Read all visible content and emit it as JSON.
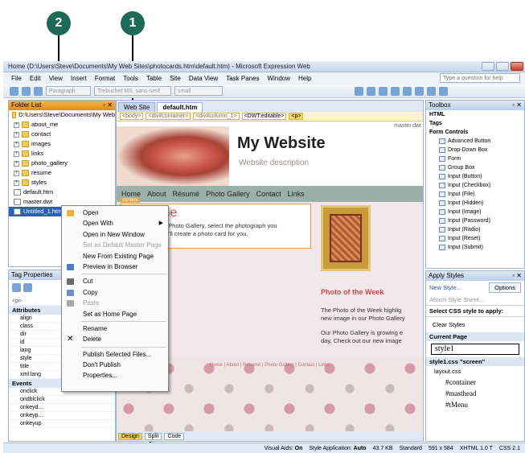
{
  "callouts": {
    "one": "1",
    "two": "2"
  },
  "window": {
    "title": "Home (D:\\Users\\Steve\\Documents\\My Web Sites\\photocards.htm\\default.htm) - Microsoft Expression Web"
  },
  "menu": [
    "File",
    "Edit",
    "View",
    "Insert",
    "Format",
    "Tools",
    "Table",
    "Site",
    "Data View",
    "Task Panes",
    "Window",
    "Help"
  ],
  "help_placeholder": "Type a question for help",
  "toolbar": {
    "style": "Paragraph",
    "font": "Trebuchet MS, sans-serif",
    "size": "small"
  },
  "folder_list": {
    "title": "Folder List",
    "items": [
      {
        "label": "D:\\Users\\Steve\\Documents\\My Web",
        "type": "root"
      },
      {
        "label": "about_me",
        "type": "folder"
      },
      {
        "label": "contact",
        "type": "folder"
      },
      {
        "label": "images",
        "type": "folder"
      },
      {
        "label": "links",
        "type": "folder"
      },
      {
        "label": "photo_gallery",
        "type": "folder"
      },
      {
        "label": "resume",
        "type": "folder"
      },
      {
        "label": "styles",
        "type": "folder"
      },
      {
        "label": "default.htm",
        "type": "file"
      },
      {
        "label": "master.dwt",
        "type": "file"
      },
      {
        "label": "Untitled_1.htm",
        "type": "file-selected"
      }
    ]
  },
  "tag_properties": {
    "title": "Tag Properties",
    "tag": "<p>",
    "attributes_header": "Attributes",
    "attributes": [
      "align",
      "class",
      "dir",
      "id",
      "lang",
      "style",
      "title",
      "xml:lang"
    ],
    "events_header": "Events",
    "events": [
      "onclick",
      "ondblclick",
      "onkeyd...",
      "onkeyp...",
      "onkeyup"
    ]
  },
  "editor": {
    "tabs": [
      "Web Site",
      "default.htm"
    ],
    "crumbs": [
      "<body>",
      "<div#container>",
      "<div#column_1>",
      "<DWT:editable>",
      "<p>"
    ],
    "master_label": "master.dwt",
    "site_title": "My Website",
    "site_desc": "Website description",
    "nav": [
      "Home",
      "About",
      "Résumé",
      "Photo Gallery",
      "Contact",
      "Links"
    ],
    "content_tag": "content",
    "welcome": "Welcome",
    "welcome_text_1": "h our Photo Gallery, select the photograph you",
    "welcome_text_2": "nd we'll create a photo card for you.",
    "potw_title": "Photo of the Week",
    "potw_text_1": "The Photo of the Week highlig",
    "potw_text_2": "new image in our Photo Gallery",
    "potw_text_3": "Our Photo Gallery is growing e",
    "potw_text_4": "day. Check out our new image",
    "footer_links": "Home | About | Résumé | Photo Gallery | Contact | Links",
    "views": [
      "Design",
      "Split",
      "Code"
    ]
  },
  "toolbox": {
    "title": "Toolbox",
    "sections": [
      "HTML",
      "Tags",
      "Form Controls"
    ],
    "items": [
      "Advanced Button",
      "Drop-Down Box",
      "Form",
      "Group Box",
      "Input (Button)",
      "Input (Checkbox)",
      "Input (File)",
      "Input (Hidden)",
      "Input (Image)",
      "Input (Password)",
      "Input (Radio)",
      "Input (Reset)",
      "Input (Submit)"
    ]
  },
  "apply_styles": {
    "title": "Apply Styles",
    "new_style": "New Style...",
    "options": "Options",
    "attach": "Attach Style Sheet...",
    "select_label": "Select CSS style to apply:",
    "clear": "Clear Styles",
    "current_page": "Current Page",
    "style1": "style1",
    "style1css": "style1.css \"screen\"",
    "layout": "layout.css",
    "rules": [
      "#container",
      "#masthead",
      "#tMenu"
    ]
  },
  "context_menu": {
    "items": [
      {
        "label": "Open",
        "disabled": false
      },
      {
        "label": "Open With",
        "disabled": false,
        "submenu": true
      },
      {
        "label": "Open in New Window",
        "disabled": false
      },
      {
        "label": "Set as Default Master Page",
        "disabled": true
      },
      {
        "label": "New From Existing Page",
        "disabled": false
      },
      {
        "label": "Preview in Browser",
        "disabled": false
      },
      {
        "label": "Cut",
        "disabled": false
      },
      {
        "label": "Copy",
        "disabled": false
      },
      {
        "label": "Paste",
        "disabled": true
      },
      {
        "label": "Set as Home Page",
        "disabled": false
      },
      {
        "label": "Rename",
        "disabled": false
      },
      {
        "label": "Delete",
        "disabled": false
      },
      {
        "label": "Publish Selected Files...",
        "disabled": false
      },
      {
        "label": "Don't Publish",
        "disabled": false
      },
      {
        "label": "Properties...",
        "disabled": false
      }
    ]
  },
  "status": {
    "visual_aids": "Visual Aids:",
    "visual_aids_val": "On",
    "style_app": "Style Application:",
    "style_app_val": "Auto",
    "size": "43.7 KB",
    "mode": "Standard",
    "dims": "591 x 584",
    "doctype": "XHTML 1.0 T",
    "css": "CSS 2.1"
  },
  "colors": {
    "callout": "#1d6b57",
    "accent": "#f0a040",
    "selection": "#2e5fb6"
  }
}
